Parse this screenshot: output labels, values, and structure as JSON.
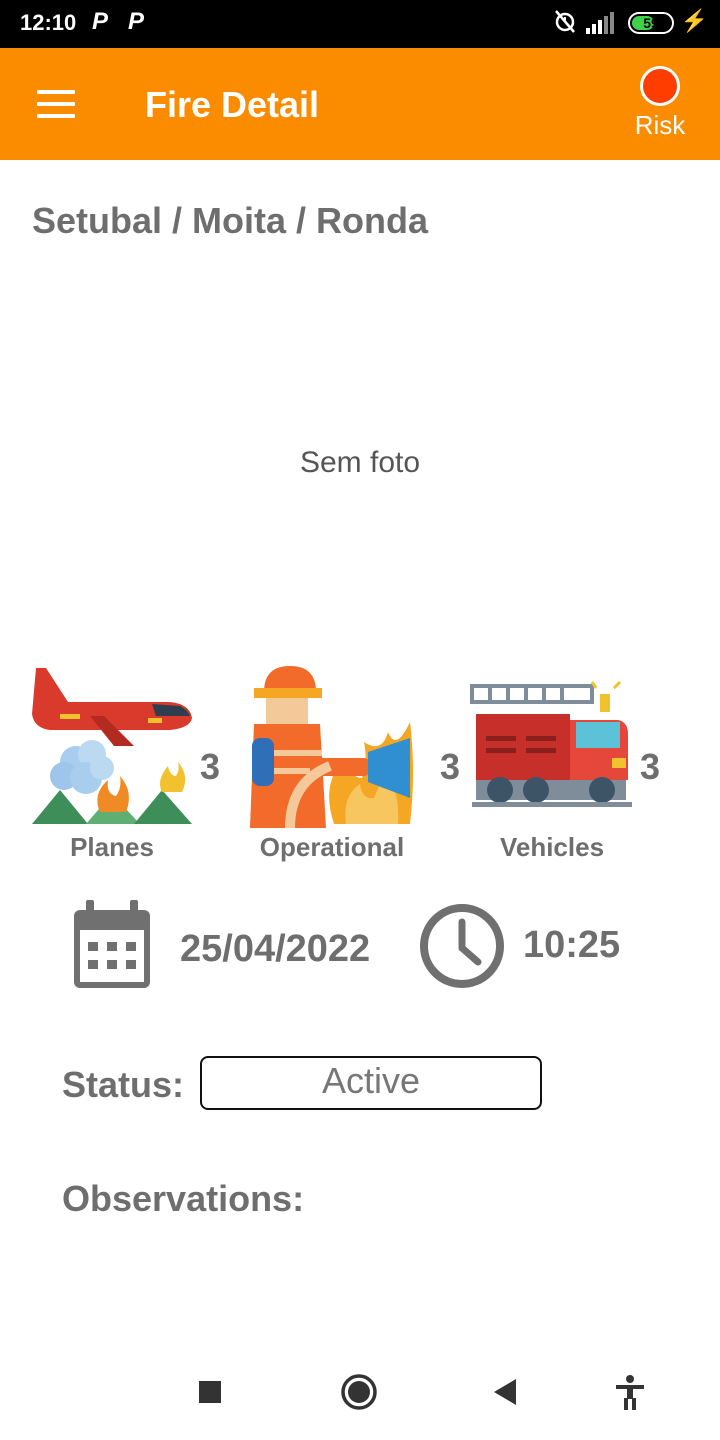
{
  "status_bar": {
    "time": "12:10",
    "notification_icons": [
      "P",
      "P"
    ],
    "battery": "59",
    "battery_level": 0.59
  },
  "app_bar": {
    "title": "Fire Detail",
    "risk_label": "Risk",
    "risk_color": "#ff3d00",
    "accent": "#fb8c00"
  },
  "location": "Setubal / Moita / Ronda",
  "photo": {
    "placeholder": "Sem foto"
  },
  "resources": [
    {
      "label": "Planes",
      "count": "3",
      "icon": "airplane-icon"
    },
    {
      "label": "Operational",
      "count": "3",
      "icon": "firefighter-icon"
    },
    {
      "label": "Vehicles",
      "count": "3",
      "icon": "fire-truck-icon"
    }
  ],
  "date": "25/04/2022",
  "time": "10:25",
  "status": {
    "label": "Status:",
    "value": "Active"
  },
  "observations": {
    "label": "Observations:"
  },
  "nav": [
    "recent-apps-icon",
    "home-icon",
    "back-icon",
    "accessibility-icon"
  ]
}
